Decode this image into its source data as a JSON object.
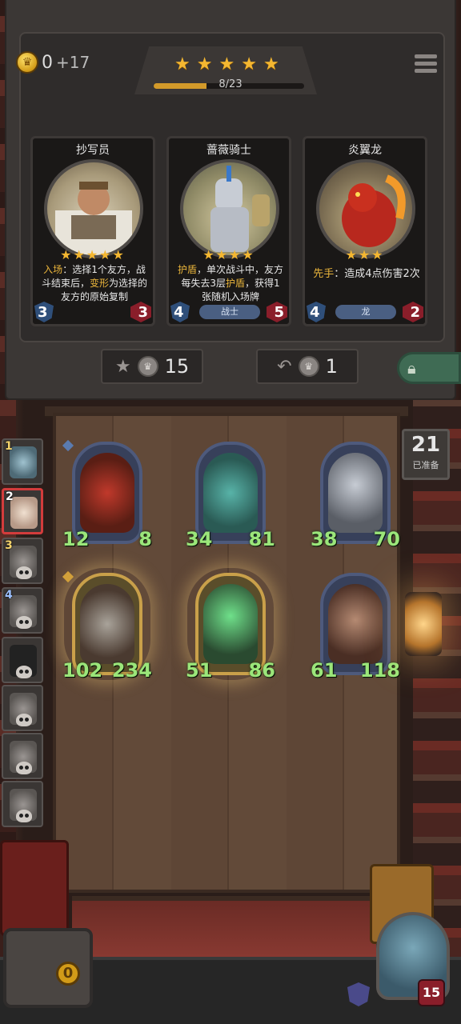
{
  "gold": {
    "value": "0",
    "income": "+17"
  },
  "tier": {
    "stars": 5,
    "progress_text": "8/23",
    "progress_fraction": 0.35
  },
  "shop_cards": [
    {
      "name": "抄写员",
      "stars": "★★★★★",
      "desc_pre": "入场",
      "desc_mid": "：选择1个友方，战斗结束后，",
      "desc_hl": "变形",
      "desc_post": "为选择的友方的原始复制",
      "attack": "3",
      "health": "3",
      "tribe": ""
    },
    {
      "name": "蔷薇骑士",
      "stars": "★★★★",
      "desc_pre": "护盾",
      "desc_mid": "，单次战斗中，友方每失去3层",
      "desc_hl": "护盾",
      "desc_post": "，获得1张随机入场牌",
      "attack": "4",
      "health": "5",
      "tribe": "战士"
    },
    {
      "name": "炎翼龙",
      "stars": "★★★",
      "desc_pre": "先手",
      "desc_mid": "：造成4点伤害2次",
      "desc_hl": "",
      "desc_post": "",
      "attack": "4",
      "health": "2",
      "tribe": "龙"
    }
  ],
  "buttons": {
    "upgrade_cost": "15",
    "refresh_cost": "1"
  },
  "ready": {
    "count": "21",
    "label": "已准备"
  },
  "pool_numbers": [
    "1",
    "2",
    "3",
    "4"
  ],
  "board": [
    {
      "attack": "12",
      "health": "8"
    },
    {
      "attack": "34",
      "health": "81"
    },
    {
      "attack": "38",
      "health": "70"
    },
    {
      "attack": "102",
      "health": "234"
    },
    {
      "attack": "51",
      "health": "86"
    },
    {
      "attack": "61",
      "health": "118"
    }
  ],
  "chest_coin": "0",
  "hero_hp": "15",
  "colors": {
    "star": "#f4b731",
    "stat_green": "#9be67a",
    "health_red": "#8a1e2a",
    "tribe_blue": "#4a5f82"
  }
}
